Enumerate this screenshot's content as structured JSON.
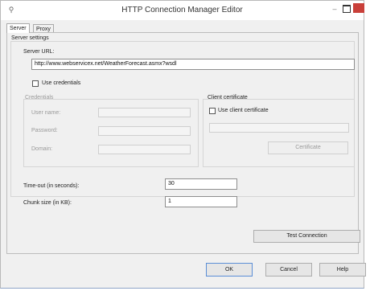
{
  "window": {
    "title": "HTTP Connection Manager Editor"
  },
  "tabs": [
    {
      "label": "Server"
    },
    {
      "label": "Proxy"
    }
  ],
  "server_settings": {
    "title": "Server settings",
    "server_url_label": "Server URL:",
    "server_url_value": "http://www.webservicex.net/WeatherForecast.asmx?wsdl",
    "use_credentials_label": "Use credentials",
    "credentials": {
      "title": "Credentials",
      "user_name_label": "User name:",
      "password_label": "Password:",
      "domain_label": "Domain:"
    },
    "client_certificate": {
      "title": "Client certificate",
      "use_client_certificate_label": "Use client certificate",
      "certificate_button": "Certificate"
    },
    "timeout_label": "Time-out (in seconds):",
    "timeout_value": "30",
    "chunk_size_label": "Chunk size (in KB):",
    "chunk_size_value": "1",
    "test_connection_button": "Test Connection"
  },
  "footer": {
    "ok": "OK",
    "cancel": "Cancel",
    "help": "Help"
  }
}
